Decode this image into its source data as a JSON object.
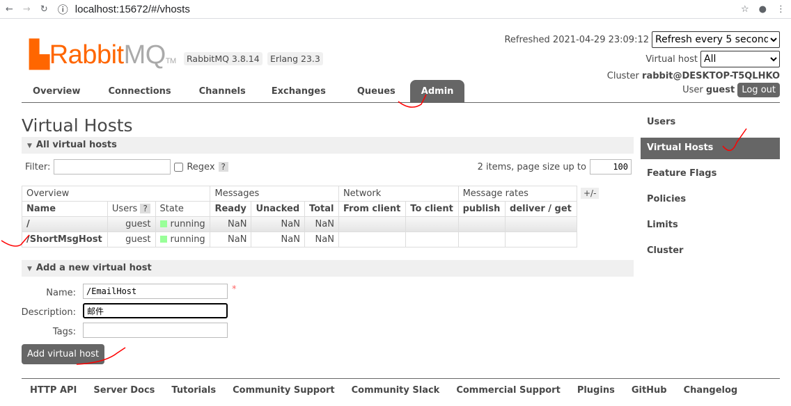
{
  "browser": {
    "url": "localhost:15672/#/vhosts"
  },
  "header": {
    "logo": "RabbitMQ",
    "logo_tm": "TM",
    "version": "RabbitMQ 3.8.14",
    "erlang": "Erlang 23.3",
    "refreshed": "Refreshed 2021-04-29 23:09:12",
    "refresh_select": "Refresh every 5 seconds",
    "vhost_label": "Virtual host",
    "vhost_select": "All",
    "cluster_label": "Cluster",
    "cluster": "rabbit@DESKTOP-T5QLHKO",
    "user_label": "User",
    "user": "guest",
    "logout": "Log out"
  },
  "tabs": [
    "Overview",
    "Connections",
    "Channels",
    "Exchanges",
    "Queues",
    "Admin"
  ],
  "page_title": "Virtual Hosts",
  "all_section": "All virtual hosts",
  "filter": {
    "label": "Filter:",
    "value": "",
    "regex": "Regex",
    "help": "?",
    "items_text": "2 items, page size up to",
    "page_size": "100"
  },
  "table": {
    "groups": [
      "Overview",
      "Messages",
      "Network",
      "Message rates"
    ],
    "plusminus": "+/-",
    "headers": [
      "Name",
      "Users",
      "State",
      "Ready",
      "Unacked",
      "Total",
      "From client",
      "To client",
      "publish",
      "deliver / get"
    ],
    "users_help": "?",
    "rows": [
      {
        "name": "/",
        "users": "guest",
        "state": "running",
        "ready": "NaN",
        "unacked": "NaN",
        "total": "NaN"
      },
      {
        "name": "/ShortMsgHost",
        "users": "guest",
        "state": "running",
        "ready": "NaN",
        "unacked": "NaN",
        "total": "NaN"
      }
    ]
  },
  "add_section": "Add a new virtual host",
  "form": {
    "name_label": "Name:",
    "name_value": "/EmailHost",
    "required": "*",
    "desc_label": "Description:",
    "desc_value": "邮件",
    "tags_label": "Tags:",
    "tags_value": "",
    "submit": "Add virtual host"
  },
  "sidebar": [
    "Users",
    "Virtual Hosts",
    "Feature Flags",
    "Policies",
    "Limits",
    "Cluster"
  ],
  "footer": [
    "HTTP API",
    "Server Docs",
    "Tutorials",
    "Community Support",
    "Community Slack",
    "Commercial Support",
    "Plugins",
    "GitHub",
    "Changelog"
  ],
  "colors": {
    "brand": "#ff6600",
    "active": "#666666",
    "running": "#99ff99",
    "annotation": "#ff0000"
  }
}
